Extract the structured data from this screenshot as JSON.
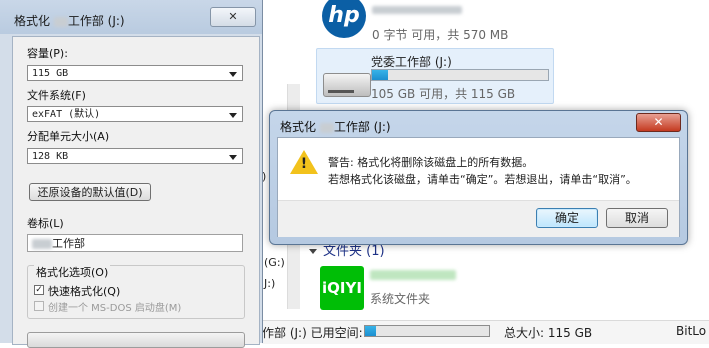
{
  "format_window": {
    "title": "格式化 ",
    "title_suffix": "工作部 (J:)",
    "close_label": "✕",
    "capacity_label": "容量(P):",
    "capacity_value": "115 GB",
    "filesystem_label": "文件系统(F)",
    "filesystem_value": "exFAT (默认)",
    "unit_label": "分配单元大小(A)",
    "unit_value": "128 KB",
    "restore_button": "还原设备的默认值(D)",
    "volume_label": "卷标(L)",
    "volume_value": "工作部",
    "options_label": "格式化选项(O)",
    "quick_format": "快速格式化(Q)",
    "msdos_label": "创建一个 MS-DOS 启动盘(M)"
  },
  "explorer": {
    "drive1_info": "0 字节 可用，共 570 MB",
    "drive2_name": "党委工作部 (J:)",
    "drive2_free_fraction": 0.09,
    "drive2_info": "105 GB 可用，共 115 GB",
    "left_g": "(G:)",
    "left_j": "J:)",
    "left_bracket": ")",
    "folder_header": "文件夹 (1)",
    "iqiyi_logo": "iQIYI",
    "iqiyi_sub": "系统文件夹",
    "status_drive": "作部 (J:) 已用空间:",
    "status_used_fraction": 0.09,
    "status_total": "总大小: 115 GB",
    "status_bitlocker": "BitLo"
  },
  "dialog": {
    "title_prefix": "格式化 ",
    "title_suffix": "工作部 (J:)",
    "close_label": "✕",
    "warning_line1": "警告: 格式化将删除该磁盘上的所有数据。",
    "warning_line2": "若想格式化该磁盘，请单击“确定”。若想退出，请单击“取消”。",
    "ok_label": "确定",
    "cancel_label": "取消",
    "warning_mark": "!"
  },
  "colors": {
    "dialog_frame": "#b5c9e1",
    "progress_fill": "#1c8fd0",
    "iqiyi_green": "#00be06"
  }
}
